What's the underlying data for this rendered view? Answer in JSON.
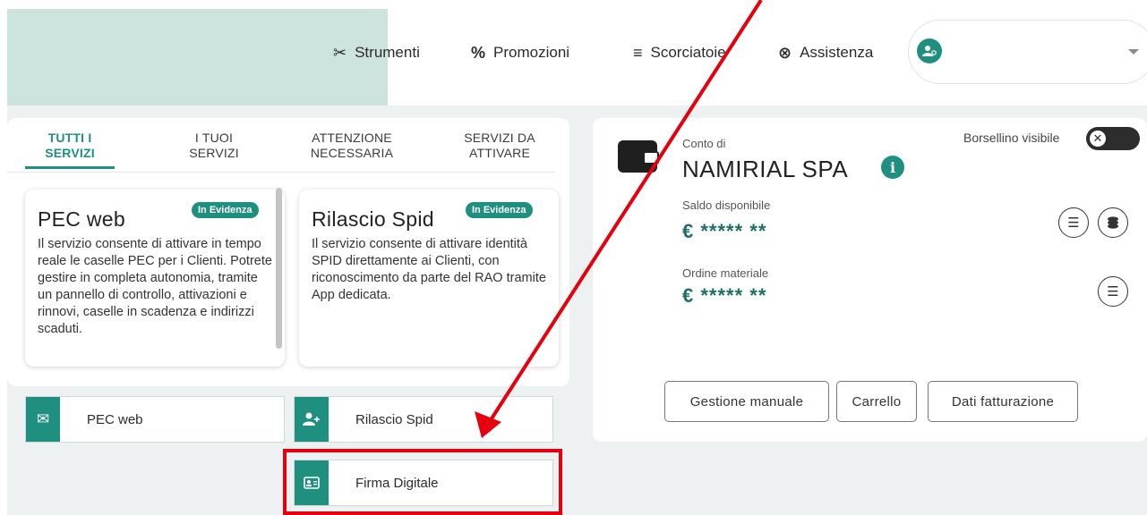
{
  "toolbar": {
    "strumenti": "Strumenti",
    "promozioni": "Promozioni",
    "scorciatoie": "Scorciatoie",
    "assistenza": "Assistenza"
  },
  "tabs": [
    {
      "line1": "TUTTI I",
      "line2": "SERVIZI"
    },
    {
      "line1": "I TUOI",
      "line2": "SERVIZI"
    },
    {
      "line1": "ATTENZIONE",
      "line2": "NECESSARIA"
    },
    {
      "line1": "SERVIZI DA",
      "line2": "ATTIVARE"
    }
  ],
  "featured": [
    {
      "title": "PEC web",
      "badge": "In Evidenza",
      "desc": "Il servizio consente di attivare in tempo reale le caselle PEC per i Clienti. Potrete gestire in completa autonomia, tramite un pannello di controllo, attivazioni e rinnovi, caselle in scadenza e indirizzi scaduti."
    },
    {
      "title": "Rilascio Spid",
      "badge": "In Evidenza",
      "desc": "Il servizio consente di attivare identità SPID direttamente ai Clienti, con riconoscimento da parte del RAO tramite App dedicata."
    }
  ],
  "services": {
    "pec": "PEC web",
    "spid": "Rilascio Spid",
    "firma": "Firma Digitale"
  },
  "wallet": {
    "toggle_label": "Borsellino visibile",
    "account_label": "Conto di",
    "company": "NAMIRIAL SPA",
    "saldo_label": "Saldo disponibile",
    "saldo_value": "€ ***** **",
    "ordine_label": "Ordine materiale",
    "ordine_value": "€ ***** **",
    "buttons": {
      "gestione": "Gestione manuale",
      "carrello": "Carrello",
      "fatturazione": "Dati fatturazione"
    }
  },
  "colors": {
    "accent": "#1f8f80",
    "annotation": "#e6000e"
  }
}
